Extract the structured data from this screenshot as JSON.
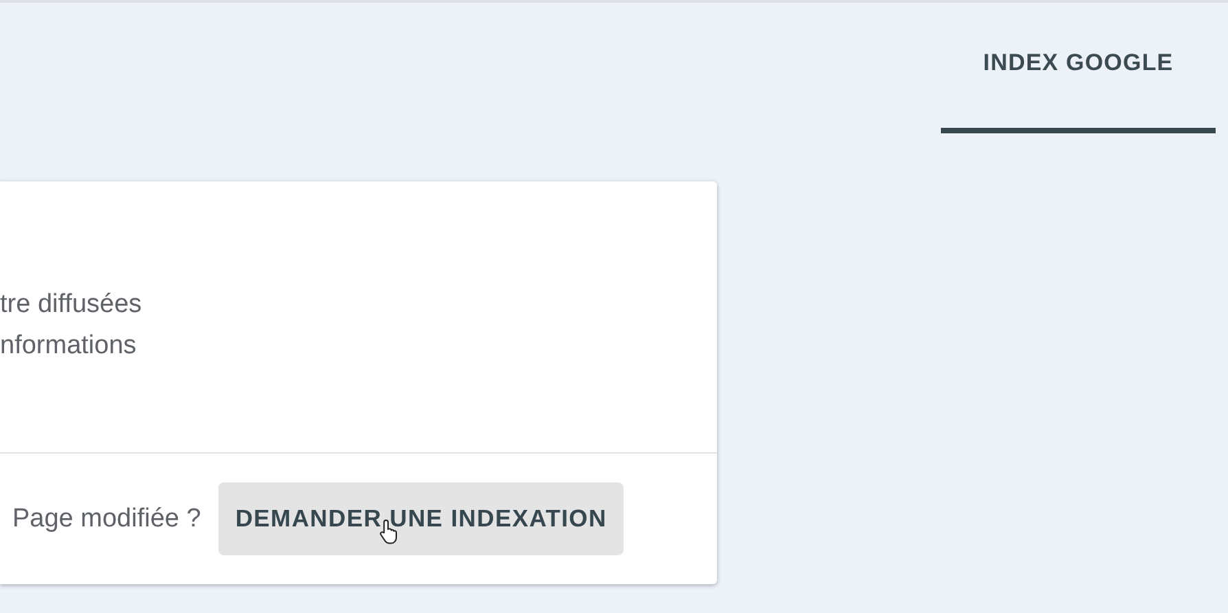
{
  "tabs": [
    {
      "label": "INDEX GOOGLE",
      "selected": true
    }
  ],
  "card": {
    "description_lines": [
      "tre diffusées",
      "nformations"
    ],
    "footer_prompt": "Page modifiée ?",
    "action_button": "DEMANDER UNE INDEXATION"
  }
}
